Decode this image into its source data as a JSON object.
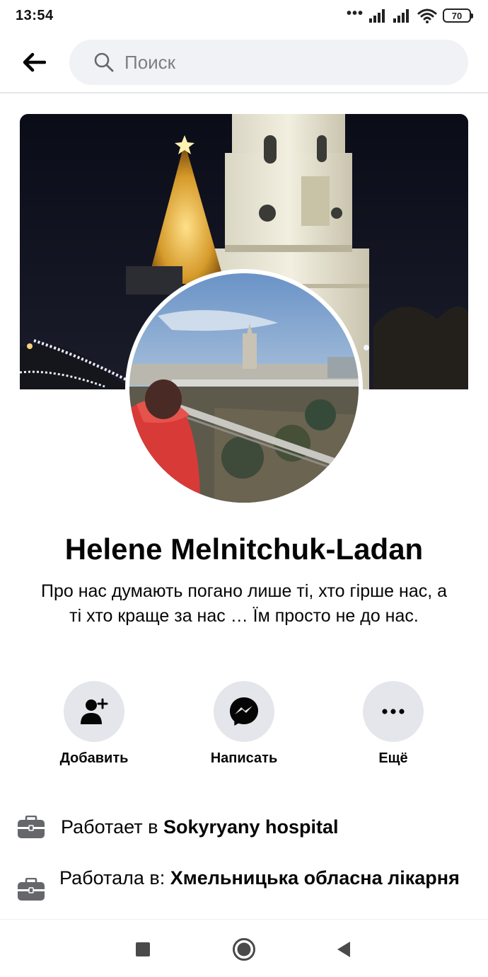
{
  "status_bar": {
    "time": "13:54",
    "more_indicator": "•••",
    "battery": "70",
    "icons": [
      "signal-icon",
      "signal-icon",
      "wifi-icon",
      "battery-icon"
    ]
  },
  "header": {
    "back_icon": "arrow-left-icon",
    "search_placeholder": "Поиск"
  },
  "profile": {
    "name": "Helene Melnitchuk-Ladan",
    "bio": "Про нас думають погано лише ті, хто гірше нас, а ті хто краще за нас … Їм просто не до нас."
  },
  "actions": [
    {
      "label": "Добавить",
      "icon": "add-friend-icon"
    },
    {
      "label": "Написать",
      "icon": "messenger-icon"
    },
    {
      "label": "Ещё",
      "icon": "more-icon"
    }
  ],
  "info": [
    {
      "prefix": "Работает в ",
      "value": "Sokyryany hospital",
      "icon": "briefcase-icon"
    },
    {
      "prefix": "Работала в: ",
      "value": "Хмельницька обласна лікарня",
      "icon": "briefcase-icon"
    }
  ],
  "navbar": {
    "icons": [
      "recents-square-icon",
      "home-circle-icon",
      "back-triangle-icon"
    ]
  },
  "colors": {
    "button_bg": "#e4e6eb",
    "search_bg": "#f0f2f5",
    "text": "#050505",
    "icon": "#050505"
  }
}
